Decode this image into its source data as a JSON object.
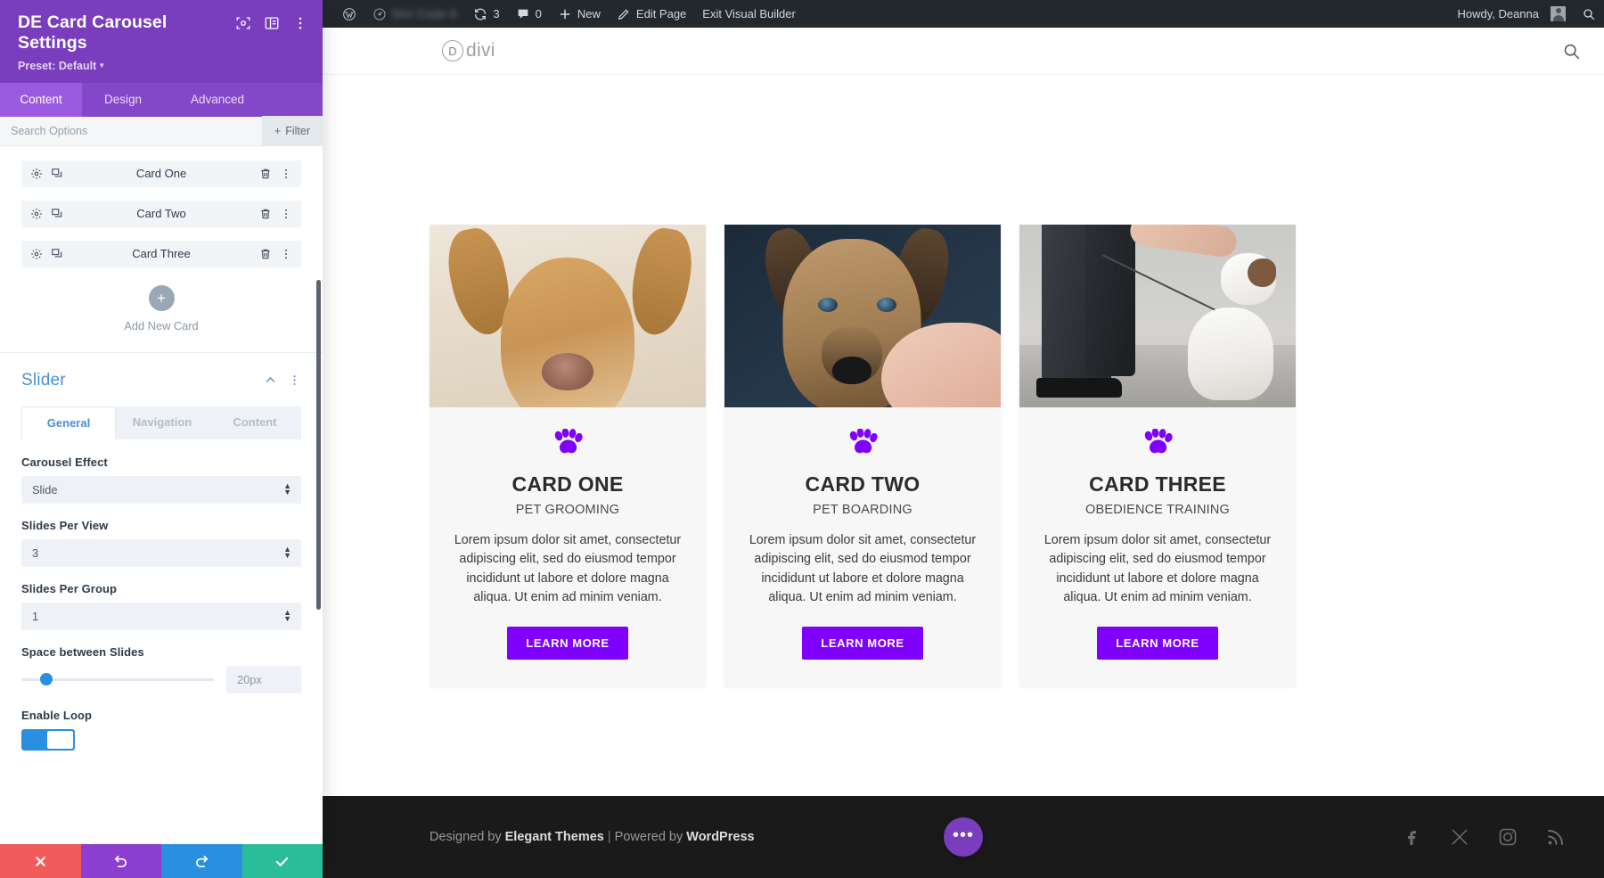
{
  "panel": {
    "title": "DE Card Carousel Settings",
    "preset": "Preset: Default",
    "tabs": [
      {
        "label": "Content",
        "active": true
      },
      {
        "label": "Design",
        "active": false
      },
      {
        "label": "Advanced",
        "active": false
      }
    ],
    "search_placeholder": "Search Options",
    "filter_label": "Filter",
    "cards": [
      {
        "label": "Card One"
      },
      {
        "label": "Card Two"
      },
      {
        "label": "Card Three"
      }
    ],
    "add_new_label": "Add New Card",
    "section": {
      "title": "Slider",
      "subtabs": [
        {
          "label": "General",
          "active": true
        },
        {
          "label": "Navigation",
          "active": false
        },
        {
          "label": "Content",
          "active": false
        }
      ],
      "fields": [
        {
          "label": "Carousel Effect",
          "value": "Slide",
          "type": "select"
        },
        {
          "label": "Slides Per View",
          "value": "3",
          "type": "select"
        },
        {
          "label": "Slides Per Group",
          "value": "1",
          "type": "select"
        },
        {
          "label": "Space between Slides",
          "value": "20px",
          "type": "range"
        },
        {
          "label": "Enable Loop",
          "value": "on",
          "type": "toggle"
        }
      ]
    },
    "footer_actions": [
      {
        "name": "discard",
        "icon": "close-icon",
        "color": "#f05a5a"
      },
      {
        "name": "undo",
        "icon": "undo-icon",
        "color": "#8b3ed0"
      },
      {
        "name": "redo",
        "icon": "redo-icon",
        "color": "#2a8fe0"
      },
      {
        "name": "save",
        "icon": "check-icon",
        "color": "#2bbd9a"
      }
    ]
  },
  "adminbar": {
    "site_name": "Divi Code A",
    "updates_count": "3",
    "comments_count": "0",
    "new_label": "New",
    "edit_page_label": "Edit Page",
    "exit_builder_label": "Exit Visual Builder",
    "howdy": "Howdy, Deanna"
  },
  "site_header": {
    "logo_letter": "D",
    "logo_word": "divi"
  },
  "cards": [
    {
      "title": "CARD ONE",
      "subtitle": "PET GROOMING",
      "body": "Lorem ipsum dolor sit amet, consectetur adipiscing elit, sed do eiusmod tempor incididunt ut labore et dolore magna aliqua. Ut enim ad minim veniam.",
      "button": "LEARN MORE",
      "image_alt": "closeup-of-tan-dog-face"
    },
    {
      "title": "CARD TWO",
      "subtitle": "PET BOARDING",
      "body": "Lorem ipsum dolor sit amet, consectetur adipiscing elit, sed do eiusmod tempor incididunt ut labore et dolore magna aliqua. Ut enim ad minim veniam.",
      "button": "LEARN MORE",
      "image_alt": "person-petting-brown-dog"
    },
    {
      "title": "CARD THREE",
      "subtitle": "OBEDIENCE TRAINING",
      "body": "Lorem ipsum dolor sit amet, consectetur adipiscing elit, sed do eiusmod tempor incididunt ut labore et dolore magna aliqua. Ut enim ad minim veniam.",
      "button": "LEARN MORE",
      "image_alt": "dog-on-leash-with-trainer"
    }
  ],
  "footer": {
    "designed_by": "Designed by ",
    "elegant_themes": "Elegant Themes",
    "separator": " | ",
    "powered_by": "Powered by ",
    "wordpress": "WordPress",
    "socials": [
      "facebook-icon",
      "x-icon",
      "instagram-icon",
      "rss-icon"
    ]
  },
  "colors": {
    "panel_purple": "#7a3dbd",
    "tab_active": "#9a5ae0",
    "accent_blue": "#4a8fd4",
    "button_purple": "#8000ff",
    "paw_purple": "#8000ff"
  }
}
